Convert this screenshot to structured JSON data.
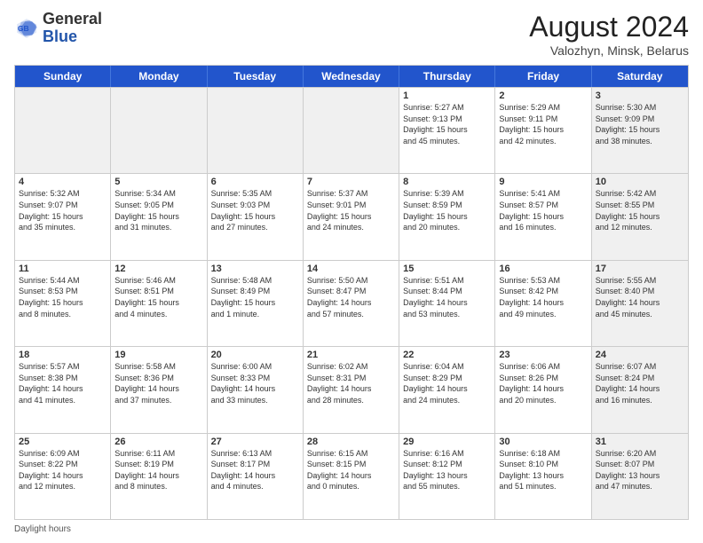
{
  "header": {
    "logo_line1": "General",
    "logo_line2": "Blue",
    "month_title": "August 2024",
    "location": "Valozhyn, Minsk, Belarus"
  },
  "days_of_week": [
    "Sunday",
    "Monday",
    "Tuesday",
    "Wednesday",
    "Thursday",
    "Friday",
    "Saturday"
  ],
  "weeks": [
    [
      {
        "day": "",
        "info": "",
        "shaded": true
      },
      {
        "day": "",
        "info": "",
        "shaded": true
      },
      {
        "day": "",
        "info": "",
        "shaded": true
      },
      {
        "day": "",
        "info": "",
        "shaded": true
      },
      {
        "day": "1",
        "info": "Sunrise: 5:27 AM\nSunset: 9:13 PM\nDaylight: 15 hours\nand 45 minutes.",
        "shaded": false
      },
      {
        "day": "2",
        "info": "Sunrise: 5:29 AM\nSunset: 9:11 PM\nDaylight: 15 hours\nand 42 minutes.",
        "shaded": false
      },
      {
        "day": "3",
        "info": "Sunrise: 5:30 AM\nSunset: 9:09 PM\nDaylight: 15 hours\nand 38 minutes.",
        "shaded": true
      }
    ],
    [
      {
        "day": "4",
        "info": "Sunrise: 5:32 AM\nSunset: 9:07 PM\nDaylight: 15 hours\nand 35 minutes.",
        "shaded": false
      },
      {
        "day": "5",
        "info": "Sunrise: 5:34 AM\nSunset: 9:05 PM\nDaylight: 15 hours\nand 31 minutes.",
        "shaded": false
      },
      {
        "day": "6",
        "info": "Sunrise: 5:35 AM\nSunset: 9:03 PM\nDaylight: 15 hours\nand 27 minutes.",
        "shaded": false
      },
      {
        "day": "7",
        "info": "Sunrise: 5:37 AM\nSunset: 9:01 PM\nDaylight: 15 hours\nand 24 minutes.",
        "shaded": false
      },
      {
        "day": "8",
        "info": "Sunrise: 5:39 AM\nSunset: 8:59 PM\nDaylight: 15 hours\nand 20 minutes.",
        "shaded": false
      },
      {
        "day": "9",
        "info": "Sunrise: 5:41 AM\nSunset: 8:57 PM\nDaylight: 15 hours\nand 16 minutes.",
        "shaded": false
      },
      {
        "day": "10",
        "info": "Sunrise: 5:42 AM\nSunset: 8:55 PM\nDaylight: 15 hours\nand 12 minutes.",
        "shaded": true
      }
    ],
    [
      {
        "day": "11",
        "info": "Sunrise: 5:44 AM\nSunset: 8:53 PM\nDaylight: 15 hours\nand 8 minutes.",
        "shaded": false
      },
      {
        "day": "12",
        "info": "Sunrise: 5:46 AM\nSunset: 8:51 PM\nDaylight: 15 hours\nand 4 minutes.",
        "shaded": false
      },
      {
        "day": "13",
        "info": "Sunrise: 5:48 AM\nSunset: 8:49 PM\nDaylight: 15 hours\nand 1 minute.",
        "shaded": false
      },
      {
        "day": "14",
        "info": "Sunrise: 5:50 AM\nSunset: 8:47 PM\nDaylight: 14 hours\nand 57 minutes.",
        "shaded": false
      },
      {
        "day": "15",
        "info": "Sunrise: 5:51 AM\nSunset: 8:44 PM\nDaylight: 14 hours\nand 53 minutes.",
        "shaded": false
      },
      {
        "day": "16",
        "info": "Sunrise: 5:53 AM\nSunset: 8:42 PM\nDaylight: 14 hours\nand 49 minutes.",
        "shaded": false
      },
      {
        "day": "17",
        "info": "Sunrise: 5:55 AM\nSunset: 8:40 PM\nDaylight: 14 hours\nand 45 minutes.",
        "shaded": true
      }
    ],
    [
      {
        "day": "18",
        "info": "Sunrise: 5:57 AM\nSunset: 8:38 PM\nDaylight: 14 hours\nand 41 minutes.",
        "shaded": false
      },
      {
        "day": "19",
        "info": "Sunrise: 5:58 AM\nSunset: 8:36 PM\nDaylight: 14 hours\nand 37 minutes.",
        "shaded": false
      },
      {
        "day": "20",
        "info": "Sunrise: 6:00 AM\nSunset: 8:33 PM\nDaylight: 14 hours\nand 33 minutes.",
        "shaded": false
      },
      {
        "day": "21",
        "info": "Sunrise: 6:02 AM\nSunset: 8:31 PM\nDaylight: 14 hours\nand 28 minutes.",
        "shaded": false
      },
      {
        "day": "22",
        "info": "Sunrise: 6:04 AM\nSunset: 8:29 PM\nDaylight: 14 hours\nand 24 minutes.",
        "shaded": false
      },
      {
        "day": "23",
        "info": "Sunrise: 6:06 AM\nSunset: 8:26 PM\nDaylight: 14 hours\nand 20 minutes.",
        "shaded": false
      },
      {
        "day": "24",
        "info": "Sunrise: 6:07 AM\nSunset: 8:24 PM\nDaylight: 14 hours\nand 16 minutes.",
        "shaded": true
      }
    ],
    [
      {
        "day": "25",
        "info": "Sunrise: 6:09 AM\nSunset: 8:22 PM\nDaylight: 14 hours\nand 12 minutes.",
        "shaded": false
      },
      {
        "day": "26",
        "info": "Sunrise: 6:11 AM\nSunset: 8:19 PM\nDaylight: 14 hours\nand 8 minutes.",
        "shaded": false
      },
      {
        "day": "27",
        "info": "Sunrise: 6:13 AM\nSunset: 8:17 PM\nDaylight: 14 hours\nand 4 minutes.",
        "shaded": false
      },
      {
        "day": "28",
        "info": "Sunrise: 6:15 AM\nSunset: 8:15 PM\nDaylight: 14 hours\nand 0 minutes.",
        "shaded": false
      },
      {
        "day": "29",
        "info": "Sunrise: 6:16 AM\nSunset: 8:12 PM\nDaylight: 13 hours\nand 55 minutes.",
        "shaded": false
      },
      {
        "day": "30",
        "info": "Sunrise: 6:18 AM\nSunset: 8:10 PM\nDaylight: 13 hours\nand 51 minutes.",
        "shaded": false
      },
      {
        "day": "31",
        "info": "Sunrise: 6:20 AM\nSunset: 8:07 PM\nDaylight: 13 hours\nand 47 minutes.",
        "shaded": true
      }
    ]
  ],
  "footer": {
    "text": "Daylight hours"
  }
}
